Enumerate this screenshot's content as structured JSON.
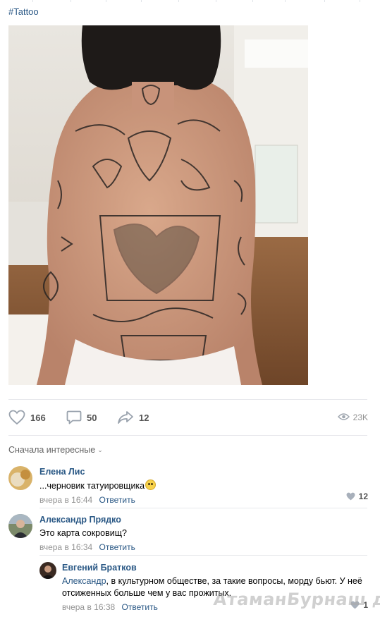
{
  "post": {
    "hashtag": "#Tattoo",
    "photo_alt": "tattooed back",
    "counts": {
      "likes": "166",
      "comments": "50",
      "shares": "12",
      "views": "23K"
    }
  },
  "comments_section": {
    "sort_label": "Сначала интересные",
    "items": [
      {
        "name": "Елена Лис",
        "text": "...черновик татуировщика",
        "time": "вчера в 16:44",
        "reply_label": "Ответить",
        "likes": "12"
      },
      {
        "name": "Александр Прядко",
        "text": "Это карта сокровищ?",
        "time": "вчера в 16:34",
        "reply_label": "Ответить",
        "likes": ""
      },
      {
        "name": "Евгений Братков",
        "reply_to": "Александр",
        "text": ", в культурном обществе, за такие вопросы, морду бьют. У неё отсиженных больше чем у вас прожитых.",
        "time": "вчера в 16:38",
        "reply_label": "Ответить",
        "likes": "1"
      }
    ]
  },
  "watermark": "АтаманБурнаш для ЯП",
  "colors": {
    "link": "#2a5885",
    "meta": "#939393",
    "separator": "#e7e8ec",
    "icon": "#99a2ad"
  },
  "icons": [
    "heart-icon",
    "comment-icon",
    "share-icon",
    "eye-icon"
  ]
}
